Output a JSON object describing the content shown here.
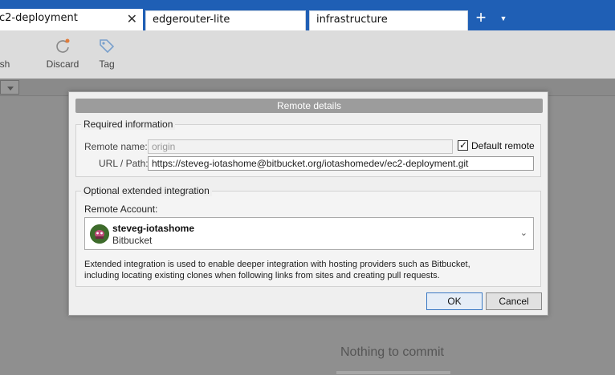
{
  "tabs": [
    {
      "label": "c2-deployment",
      "active": true
    },
    {
      "label": "edgerouter-lite",
      "active": false
    },
    {
      "label": "infrastructure",
      "active": false
    }
  ],
  "tabbar": {
    "plus": "+",
    "menu": "▼"
  },
  "toolbar": {
    "items": [
      {
        "label": "sh",
        "icon": "push-icon"
      },
      {
        "label": "Discard",
        "icon": "discard-icon"
      },
      {
        "label": "Tag",
        "icon": "tag-icon"
      }
    ]
  },
  "background": {
    "nothing_to_commit": "Nothing to commit"
  },
  "dialog": {
    "title": "Remote details",
    "required_group": "Required information",
    "remote_name_label": "Remote name:",
    "remote_name_value": "origin",
    "default_remote_label": "Default remote",
    "default_remote_checked": true,
    "url_label": "URL / Path:",
    "url_value": "https://steveg-iotashome@bitbucket.org/iotashomedev/ec2-deployment.git",
    "optional_group": "Optional extended integration",
    "remote_account_label": "Remote Account:",
    "account": {
      "name": "steveg-iotashome",
      "host": "Bitbucket"
    },
    "description_line1": "Extended integration is used to enable deeper integration with hosting providers such as Bitbucket,",
    "description_line2": "including locating existing clones when following links from sites and creating pull requests.",
    "ok_label": "OK",
    "cancel_label": "Cancel"
  },
  "colors": {
    "tabbar": "#1f5fb5",
    "accent": "#3b79c4"
  }
}
